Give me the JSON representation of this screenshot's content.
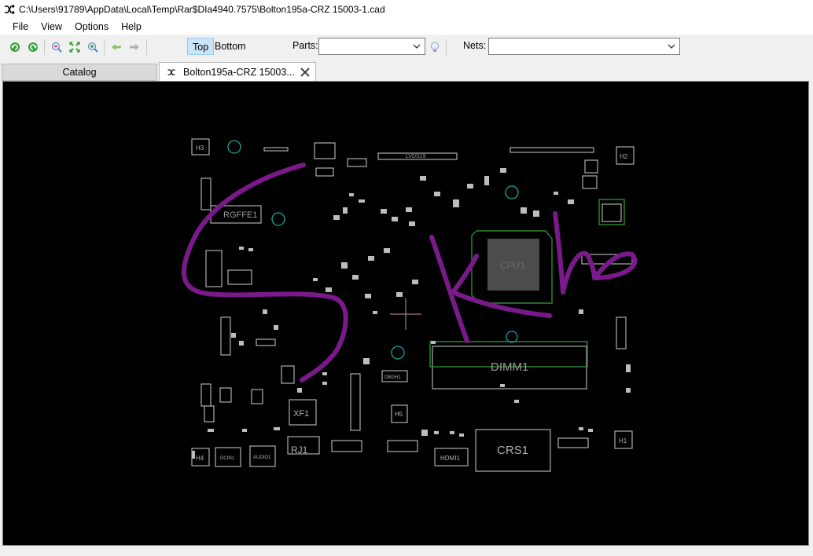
{
  "window": {
    "title": "C:\\Users\\91789\\AppData\\Local\\Temp\\Rar$DIa4940.7575\\Bolton195a-CRZ 15003-1.cad"
  },
  "menu": [
    "File",
    "View",
    "Options",
    "Help"
  ],
  "toolbar": {
    "top_label": "Top",
    "bottom_label": "Bottom",
    "parts_label": "Parts:",
    "parts_value": "",
    "nets_label": "Nets:",
    "nets_value": ""
  },
  "tabs": {
    "catalog": "Catalog",
    "document": "Bolton195a-CRZ 15003..."
  },
  "board": {
    "labels": {
      "lvds": "LVDS19",
      "cpu": "CPU1",
      "dimm": "DIMM1",
      "crs": "CRS1",
      "hdmi": "HDMI1",
      "rj": "RJ1",
      "xf": "XF1",
      "dcin": "DCIN1",
      "rgffe": "RGFFE1",
      "h1": "H1",
      "h2": "H2",
      "h3": "H3",
      "h4": "H4",
      "h5": "H5",
      "dbgh": "DBGH1",
      "audio": "AUDIO1"
    }
  },
  "colors": {
    "board_bg": "#000000",
    "outline": "#cfcfcf",
    "green_outline": "#2e8b2e",
    "teal_via": "#1aa59a",
    "annotation": "#7a1a8a",
    "crosshair": "#c89696",
    "active_toggle": "#cce4f7"
  }
}
